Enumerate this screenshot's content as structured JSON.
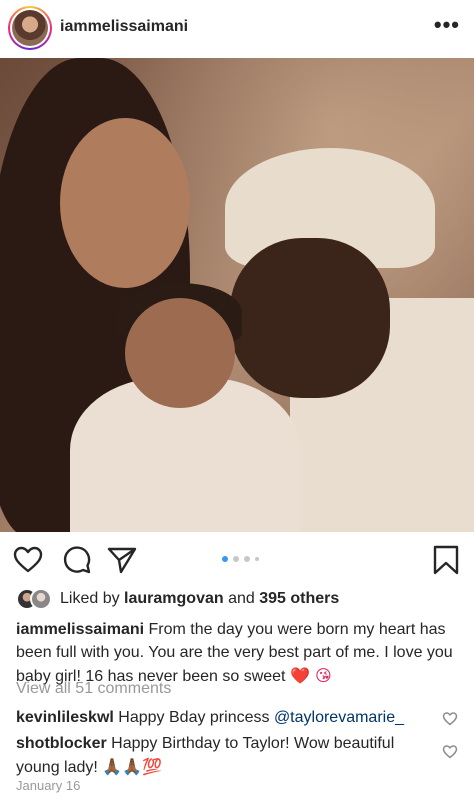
{
  "header": {
    "username": "iammelissaimani",
    "more_label": "•••"
  },
  "post": {
    "carousel_count": 4,
    "carousel_active_index": 0
  },
  "likes": {
    "prefix": "Liked by ",
    "first_liker": "lauramgovan",
    "middle": " and ",
    "others": "395 others"
  },
  "caption": {
    "username": "iammelissaimani",
    "text": "From the day you were born my heart has been full with you. You are the very best part of me. I love you baby girl! 16 has never been so sweet ",
    "emoji": "❤️ 😘"
  },
  "comments": {
    "view_all": "View all 51 comments",
    "items": [
      {
        "username": "kevinlileskwl",
        "text": "Happy Bday princess ",
        "mention": "@taylorevamarie_"
      },
      {
        "username": "shotblocker",
        "text": "Happy Birthday to Taylor! Wow beautiful young lady! ",
        "emoji": "🙏🏾🙏🏾💯"
      }
    ]
  },
  "date": "January 16",
  "icons": {
    "like": "heart-icon",
    "comment": "comment-icon",
    "share": "share-icon",
    "save": "bookmark-icon",
    "more": "more-icon"
  },
  "colors": {
    "text": "#262626",
    "muted": "#999999",
    "carousel_active": "#3897f0",
    "mention": "#003569"
  }
}
